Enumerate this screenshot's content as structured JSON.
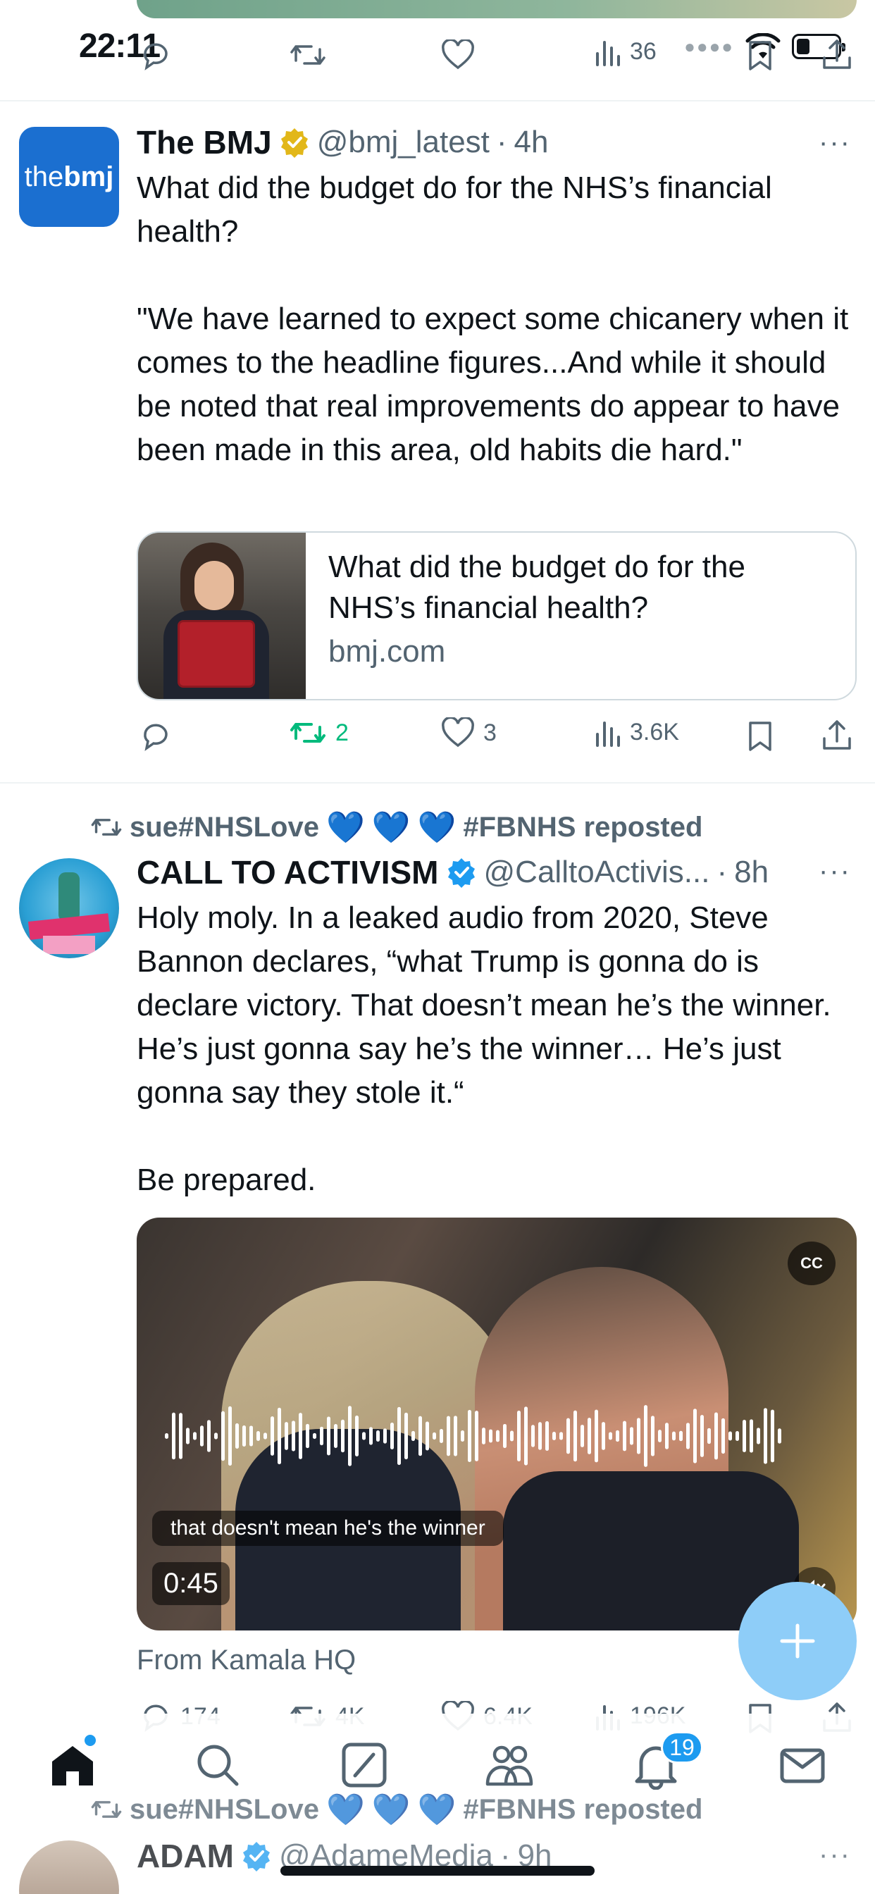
{
  "status_bar": {
    "time": "22:11"
  },
  "prev_tweet_actions": {
    "views": "36"
  },
  "tweet1": {
    "name": "The BMJ",
    "handle": "@bmj_latest",
    "time": "4h",
    "avatar_text_a": "the",
    "avatar_text_b": "bmj",
    "text": "What did the budget do for the NHS’s financial health?\n\n\"We have learned to expect some chicanery when it comes to the headline figures...And while it should be noted that real improvements do appear to have been made in this area, old habits die hard.\"",
    "card_title": "What did the budget do for the NHS’s financial health?",
    "card_domain": "bmj.com",
    "reposts": "2",
    "likes": "3",
    "views": "3.6K"
  },
  "tweet2": {
    "reposted_by": "sue#NHSLove",
    "reposted_suffix": "#FBNHS reposted",
    "name": "CALL TO ACTIVISM",
    "handle": "@CalltoActivis...",
    "time": "8h",
    "text": "Holy moly. In a leaked audio from 2020, Steve Bannon declares, “what Trump is gonna do is declare victory. That doesn’t mean he’s the winner. He’s just gonna say he’s the winner… He’s just gonna say they stole it.“\n\nBe prepared.",
    "video_caption": "that doesn't mean he's the winner",
    "video_duration": "0:45",
    "cc_label": "CC",
    "source": "From Kamala HQ",
    "replies": "174",
    "reposts": "4K",
    "likes": "6.4K",
    "views": "196K"
  },
  "tweet3": {
    "reposted_by": "sue#NHSLove",
    "reposted_suffix": "#FBNHS reposted",
    "name": "ADAM",
    "handle": "@AdameMedia",
    "time": "9h"
  },
  "tabbar": {
    "notifications_badge": "19"
  },
  "colors": {
    "accent": "#1d9bf0",
    "repost_green": "#00ba7c",
    "secondary_text": "#536471"
  }
}
